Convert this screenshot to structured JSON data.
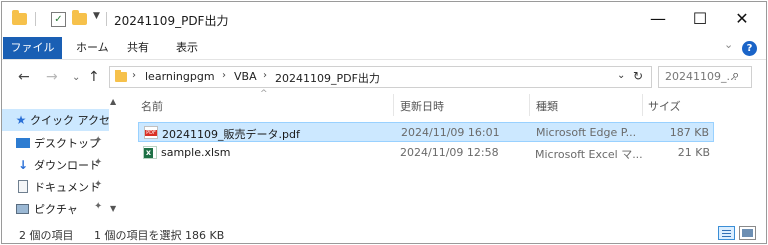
{
  "window": {
    "title": "20241109_PDF出力",
    "buttons": {
      "minimize": "—",
      "maximize": "☐",
      "close": "✕"
    },
    "qat_dropdown": "▼"
  },
  "ribbon": {
    "file_tab": "ファイル",
    "tabs": [
      "ホーム",
      "共有",
      "表示"
    ],
    "collapse": "⌄",
    "help": "?"
  },
  "address": {
    "back": "←",
    "forward": "→",
    "recent": "⌄",
    "up": "↑",
    "breadcrumbs": [
      "learningpgm",
      "VBA",
      "20241109_PDF出力"
    ],
    "separator": "›",
    "dropdown": "⌄",
    "refresh": "↻"
  },
  "search": {
    "placeholder": "20241109_..."
  },
  "nav": {
    "items": [
      {
        "label": "クイック アクセ",
        "icon": "star-icon"
      },
      {
        "label": "デスクトップ",
        "icon": "desktop-icon"
      },
      {
        "label": "ダウンロード",
        "icon": "download-icon"
      },
      {
        "label": "ドキュメント",
        "icon": "documents-icon"
      },
      {
        "label": "ピクチャ",
        "icon": "pictures-icon"
      }
    ],
    "pin": "📌",
    "scroll_up": "▲",
    "scroll_down": "▼"
  },
  "columns": {
    "sort_indicator": "^",
    "name": "名前",
    "date": "更新日時",
    "type": "種類",
    "size": "サイズ"
  },
  "files": [
    {
      "name": "20241109_販売データ.pdf",
      "date": "2024/11/09 16:01",
      "type": "Microsoft Edge P...",
      "size": "187 KB",
      "icon": "pdf-file-icon",
      "selected": true
    },
    {
      "name": "sample.xlsm",
      "date": "2024/11/09 12:58",
      "type": "Microsoft Excel マ...",
      "size": "21 KB",
      "icon": "excel-file-icon",
      "selected": false
    }
  ],
  "status": {
    "item_count": "2 個の項目",
    "selection": "1 個の項目を選択  186 KB"
  },
  "colors": {
    "accent": "#1a5fb4",
    "selection": "#cce8ff",
    "folder": "#f6c14b"
  }
}
